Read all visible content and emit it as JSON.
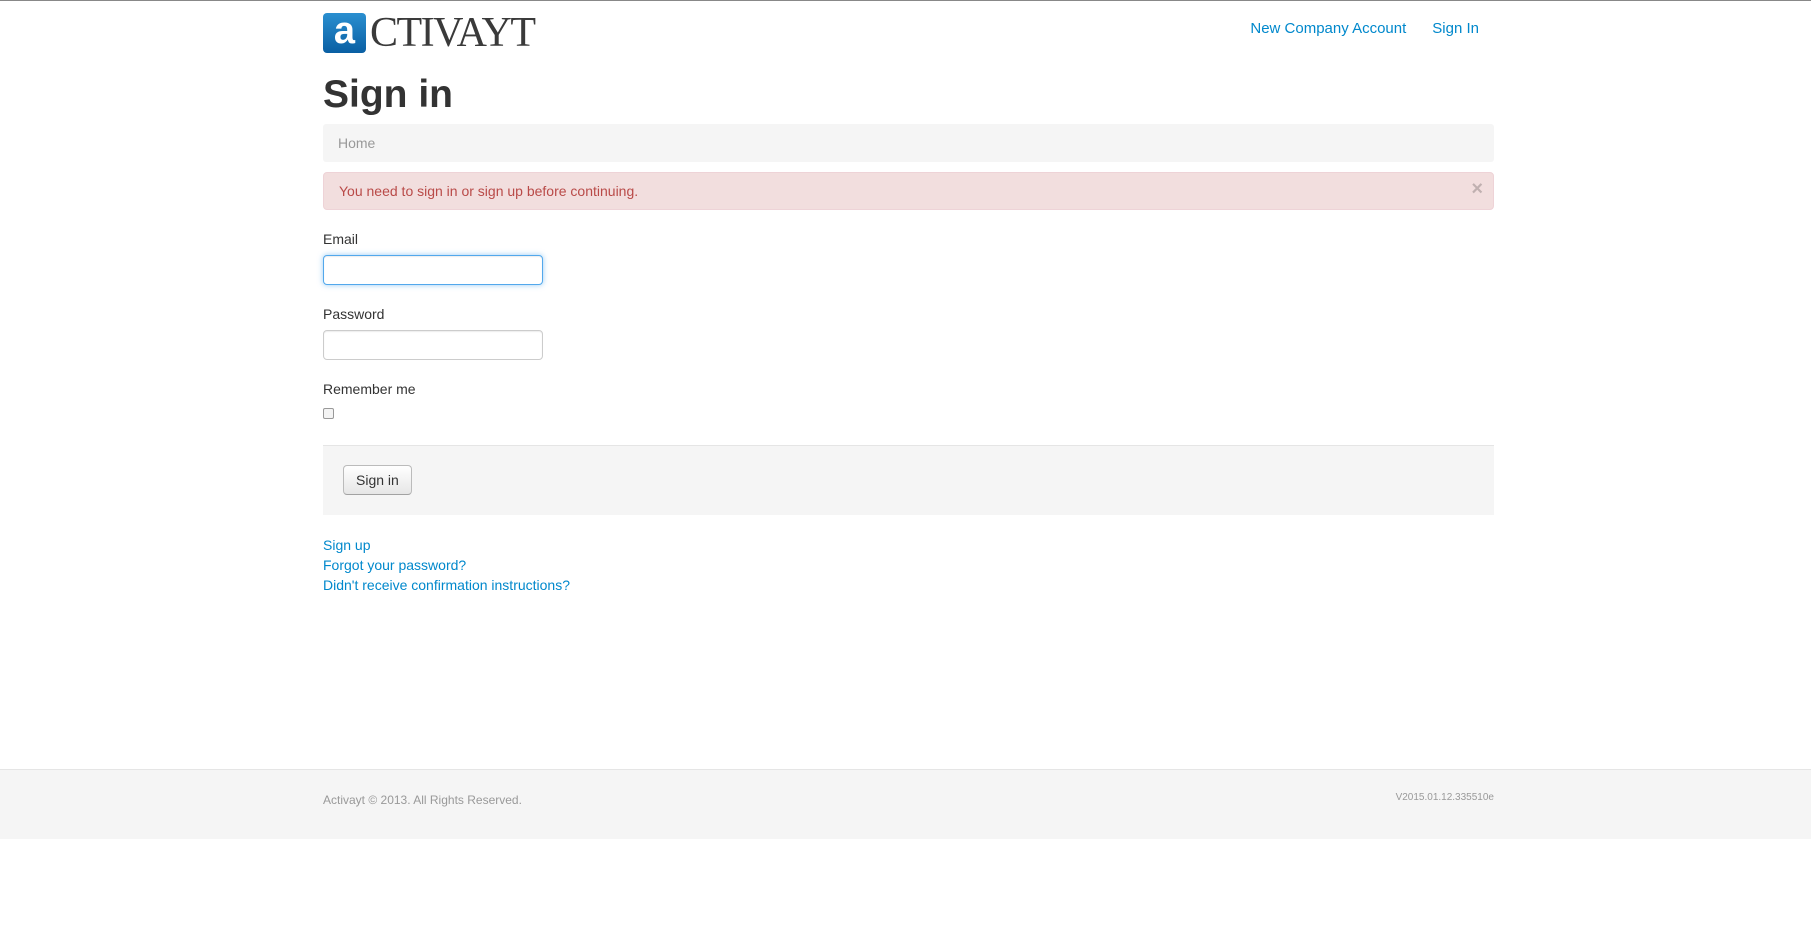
{
  "brand": {
    "logo_letter": "a",
    "logo_text": "CTIVAYT"
  },
  "nav": {
    "items": [
      {
        "label": "New Company Account"
      },
      {
        "label": "Sign In"
      }
    ]
  },
  "page": {
    "title": "Sign in",
    "breadcrumb": "Home"
  },
  "alert": {
    "message": "You need to sign in or sign up before continuing.",
    "close_symbol": "×"
  },
  "form": {
    "email_label": "Email",
    "email_value": "",
    "password_label": "Password",
    "password_value": "",
    "remember_label": "Remember me",
    "remember_checked": false,
    "submit_label": "Sign in"
  },
  "links": [
    {
      "label": "Sign up"
    },
    {
      "label": "Forgot your password?"
    },
    {
      "label": "Didn't receive confirmation instructions?"
    }
  ],
  "footer": {
    "copyright": "Activayt © 2013. All Rights Reserved.",
    "version": "V2015.01.12.335510e"
  },
  "colors": {
    "link": "#0088cc",
    "alert_bg": "#f2dede",
    "alert_text": "#b94a48",
    "logo_blue": "#1a7fc4"
  }
}
